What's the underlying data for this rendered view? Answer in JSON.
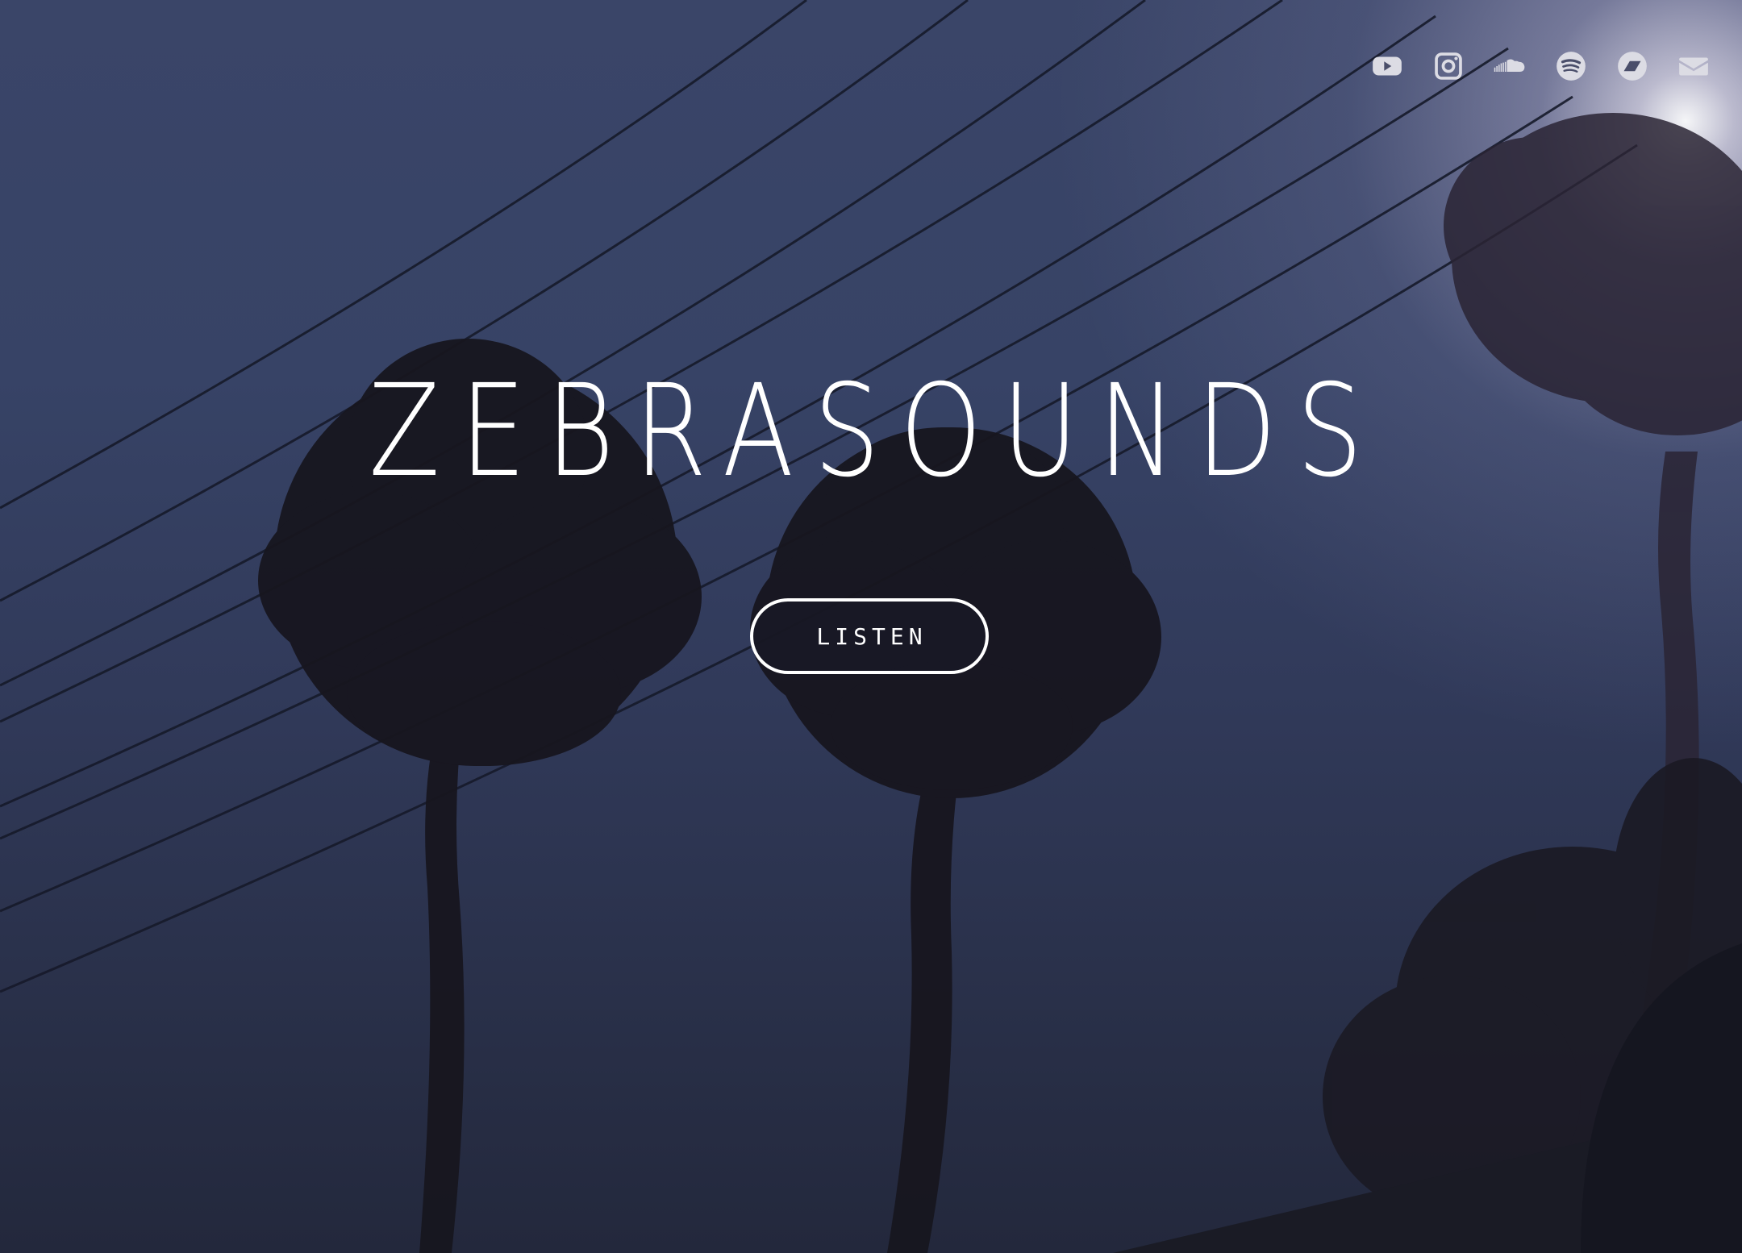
{
  "brand": {
    "title": "ZEBRASOUNDS"
  },
  "cta": {
    "label": "LISTEN"
  },
  "social": [
    {
      "icon": "youtube-icon"
    },
    {
      "icon": "instagram-icon"
    },
    {
      "icon": "soundcloud-icon"
    },
    {
      "icon": "spotify-icon"
    },
    {
      "icon": "bandcamp-icon"
    },
    {
      "icon": "email-icon"
    }
  ],
  "colors": {
    "text": "#ffffff",
    "icon": "#dcdce4",
    "sky_top": "#3a4568",
    "sky_bottom": "#23283c"
  }
}
